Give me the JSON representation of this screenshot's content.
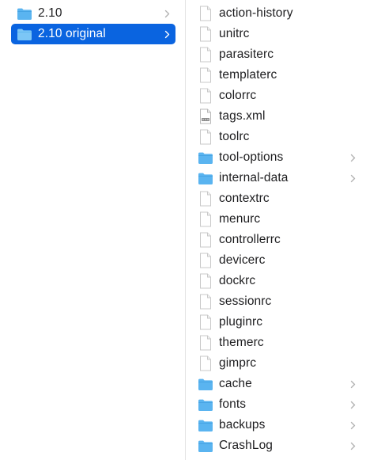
{
  "left_column": {
    "items": [
      {
        "label": "2.10",
        "kind": "folder",
        "selected": false
      },
      {
        "label": "2.10 original",
        "kind": "folder",
        "selected": true
      }
    ]
  },
  "right_column": {
    "items": [
      {
        "label": "action-history",
        "kind": "file"
      },
      {
        "label": "unitrc",
        "kind": "file"
      },
      {
        "label": "parasiterc",
        "kind": "file"
      },
      {
        "label": "templaterc",
        "kind": "file"
      },
      {
        "label": "colorrc",
        "kind": "file"
      },
      {
        "label": "tags.xml",
        "kind": "xml"
      },
      {
        "label": "toolrc",
        "kind": "file"
      },
      {
        "label": "tool-options",
        "kind": "folder"
      },
      {
        "label": "internal-data",
        "kind": "folder"
      },
      {
        "label": "contextrc",
        "kind": "file"
      },
      {
        "label": "menurc",
        "kind": "file"
      },
      {
        "label": "controllerrc",
        "kind": "file"
      },
      {
        "label": "devicerc",
        "kind": "file"
      },
      {
        "label": "dockrc",
        "kind": "file"
      },
      {
        "label": "sessionrc",
        "kind": "file"
      },
      {
        "label": "pluginrc",
        "kind": "file"
      },
      {
        "label": "themerc",
        "kind": "file"
      },
      {
        "label": "gimprc",
        "kind": "file"
      },
      {
        "label": "cache",
        "kind": "folder"
      },
      {
        "label": "fonts",
        "kind": "folder"
      },
      {
        "label": "backups",
        "kind": "folder"
      },
      {
        "label": "CrashLog",
        "kind": "folder"
      }
    ]
  },
  "colors": {
    "selection": "#0a64e0",
    "folder": "#5ab4f0",
    "text": "#1d1d1f",
    "chevron": "#b3b3b3"
  }
}
